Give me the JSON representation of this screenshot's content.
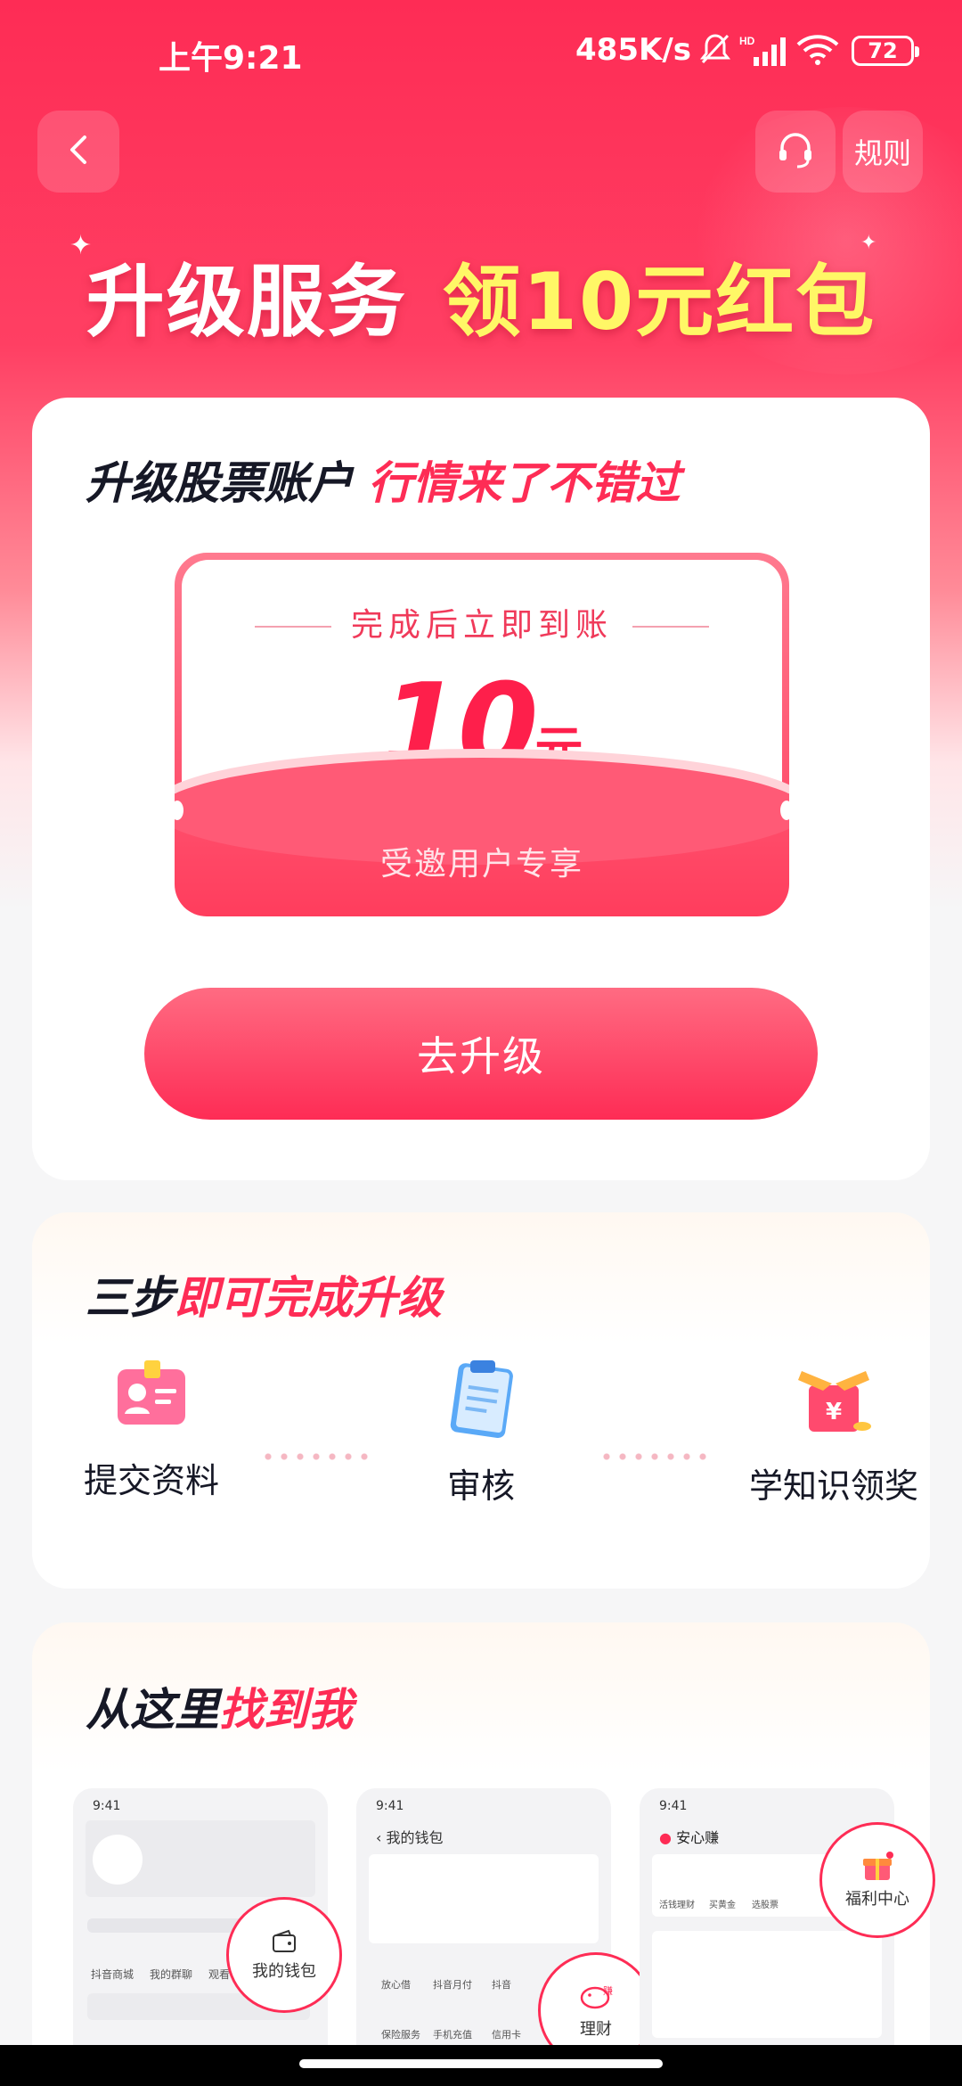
{
  "status_bar": {
    "time": "上午9:21",
    "net_speed": "485K/s",
    "battery": "72",
    "icons": [
      "mute-icon",
      "hd-signal-icon",
      "wifi-icon",
      "battery-icon"
    ]
  },
  "header": {
    "back_icon": "chevron-left-icon",
    "support_icon": "headset-icon",
    "rules_label": "规则"
  },
  "banner": {
    "part1": "升级服务",
    "part2": "领10元红包"
  },
  "reward_card": {
    "title_dark": "升级股票账户",
    "title_red": "行情来了不错过",
    "coupon_caption": "完成后立即到账",
    "amount": "10",
    "unit": "元",
    "exclusive": "受邀用户专享",
    "cta_label": "去升级"
  },
  "steps_card": {
    "title_dark": "三步",
    "title_red": "即可完成升级",
    "steps": [
      {
        "label": "提交资料",
        "icon": "id-card-icon"
      },
      {
        "label": "审核",
        "icon": "clipboard-icon"
      },
      {
        "label": "学知识领奖",
        "icon": "gift-box-icon"
      }
    ]
  },
  "find_card": {
    "title_dark": "从这里",
    "title_red": "找到我",
    "phones": [
      {
        "time": "9:41",
        "header": "",
        "items": [
          "抖音商城",
          "我的群聊",
          "观看"
        ],
        "bubble": "我的钱包",
        "bubble_icon": "wallet-icon"
      },
      {
        "time": "9:41",
        "header": "我的钱包",
        "items": [
          "放心借",
          "抖音月付",
          "抖音",
          "保险服务",
          "手机充值",
          "信用卡"
        ],
        "bubble": "理财",
        "bubble_icon": "piggy-bank-icon"
      },
      {
        "time": "9:41",
        "header": "安心赚",
        "items": [
          "活钱理财",
          "买黄金",
          "选股票"
        ],
        "bubble": "福利中心",
        "bubble_icon": "gift-icon"
      }
    ]
  },
  "colors": {
    "accent": "#fe2c55",
    "banner_highlight": "#fff766",
    "title_dark": "#161826"
  }
}
